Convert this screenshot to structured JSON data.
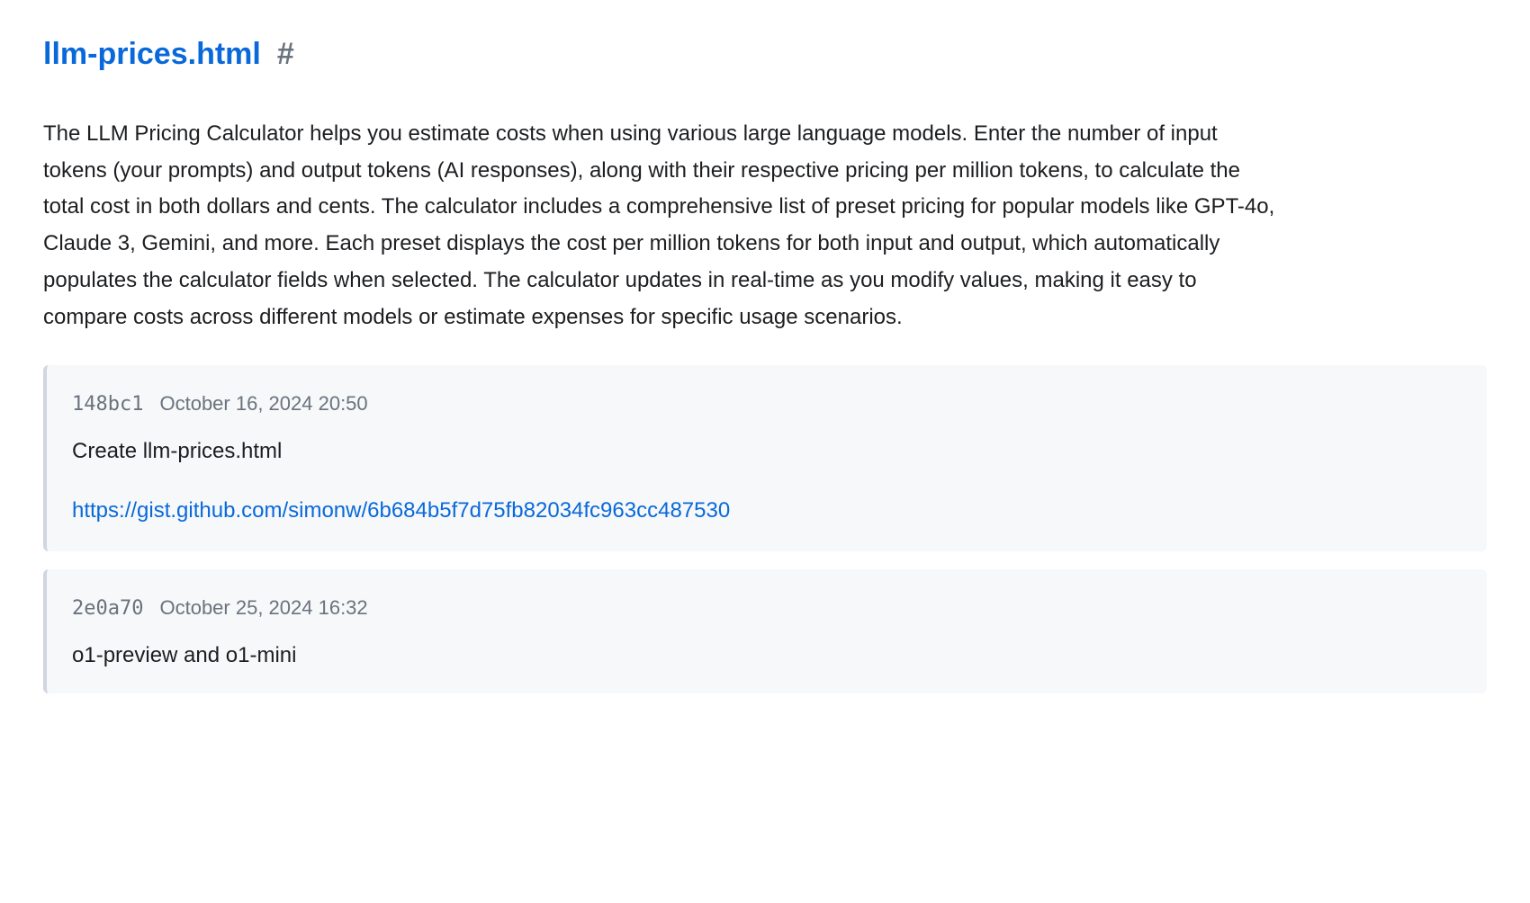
{
  "title": {
    "text": "llm-prices.html",
    "anchor": "#"
  },
  "description": "The LLM Pricing Calculator helps you estimate costs when using various large language models. Enter the number of input tokens (your prompts) and output tokens (AI responses), along with their respective pricing per million tokens, to calculate the total cost in both dollars and cents. The calculator includes a comprehensive list of preset pricing for popular models like GPT-4o, Claude 3, Gemini, and more. Each preset displays the cost per million tokens for both input and output, which automatically populates the calculator fields when selected. The calculator updates in real-time as you modify values, making it easy to compare costs across different models or estimate expenses for specific usage scenarios.",
  "commits": [
    {
      "hash": "148bc1",
      "date": "October 16, 2024 20:50",
      "message": "Create llm-prices.html",
      "link": "https://gist.github.com/simonw/6b684b5f7d75fb82034fc963cc487530"
    },
    {
      "hash": "2e0a70",
      "date": "October 25, 2024 16:32",
      "message": "o1-preview and o1-mini",
      "link": null
    }
  ]
}
